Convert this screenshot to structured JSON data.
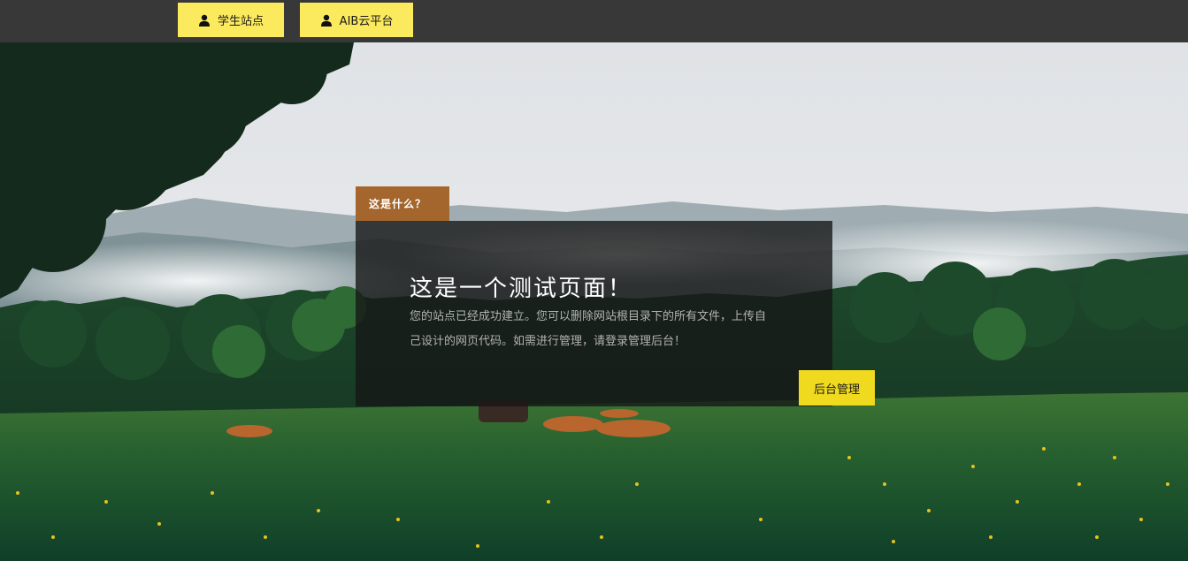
{
  "topbar": {
    "buttons": [
      {
        "label": "学生站点",
        "icon": "user-icon"
      },
      {
        "label": "AIB云平台",
        "icon": "user-icon"
      }
    ]
  },
  "card": {
    "tag": "这是什么？",
    "title": "这是一个测试页面！",
    "body": "您的站点已经成功建立。您可以删除网站根目录下的所有文件，上传自己设计的网页代码。如需进行管理，请登录管理后台！",
    "button_label": "后台管理"
  },
  "colors": {
    "topbar": "#383838",
    "nav_button": "#fbe95e",
    "tag": "#a4662c",
    "admin_button": "#f0da1f"
  }
}
